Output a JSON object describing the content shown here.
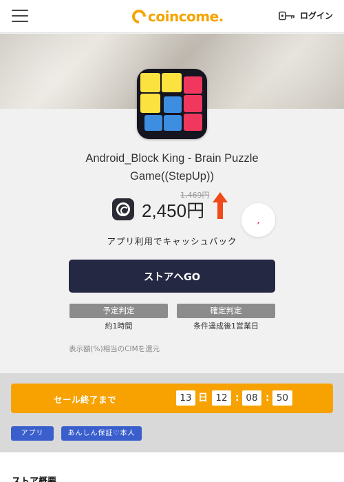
{
  "header": {
    "logo_text": "coincome.",
    "login_label": "ログイン",
    "brand_color": "#f5a400"
  },
  "app": {
    "title": "Android_Block King - Brain Puzzle Game((StepUp))",
    "old_price": "1,469円",
    "price": "2,450円",
    "cashback_note": "アプリ利用でキャッシュバック",
    "store_button": "ストアへGO",
    "rebate_note": "表示額(%)相当のCIMを還元"
  },
  "judgement": [
    {
      "label": "予定判定",
      "value": "約1時間"
    },
    {
      "label": "確定判定",
      "value": "条件達成後1営業日"
    }
  ],
  "sale": {
    "label": "セール終了まで",
    "days": "13",
    "day_unit": "日",
    "hours": "12",
    "minutes": "08",
    "seconds": "50",
    "sep": ":"
  },
  "tags": [
    "アプリ",
    "あんしん保証♡本人"
  ],
  "overview_title": "ストア概要",
  "icons": [
    "hamburger-icon",
    "key-icon",
    "coin-icon",
    "up-arrow-icon",
    "favorite-icon"
  ]
}
